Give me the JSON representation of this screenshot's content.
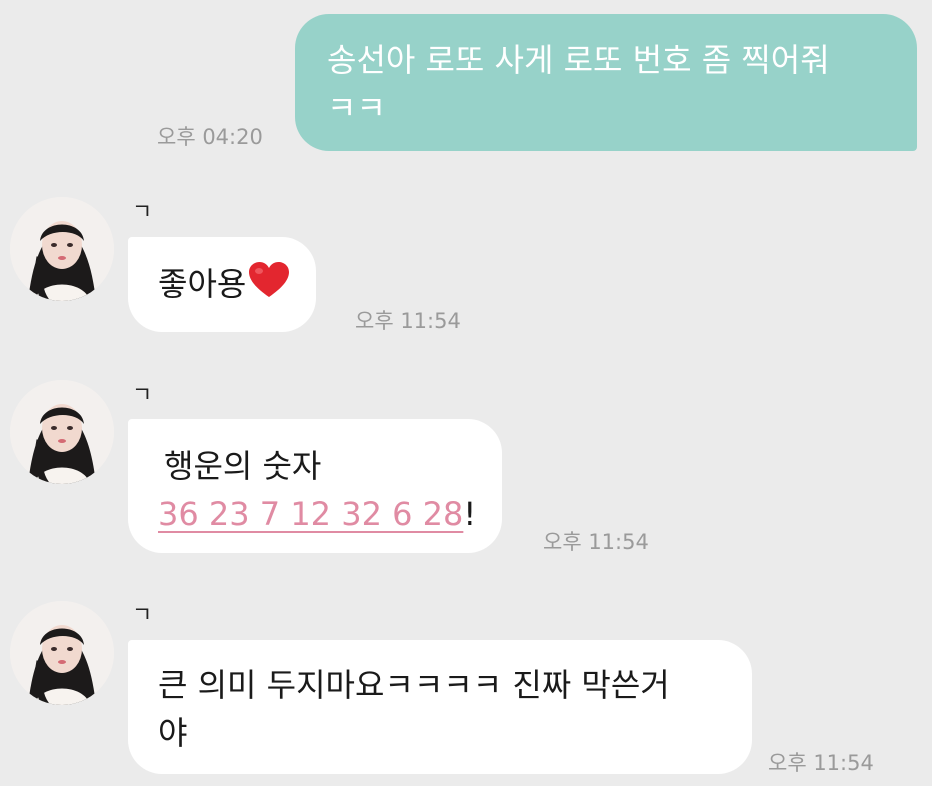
{
  "messages": [
    {
      "direction": "outgoing",
      "text_line1": "송선아 로또 사게 로또 번호 좀 찍어줘",
      "text_line2": "ㅋㅋ",
      "time": "오후 04:20"
    },
    {
      "direction": "incoming",
      "sender": "ㄱ",
      "text": "좋아용",
      "emoji": "heart-icon",
      "time": "오후 11:54"
    },
    {
      "direction": "incoming",
      "sender": "ㄱ",
      "text_line1": "행운의 숫자",
      "numbers": "36 23 7 12 32 6 28",
      "suffix": "!",
      "time": "오후 11:54"
    },
    {
      "direction": "incoming",
      "sender": "ㄱ",
      "text_line1": "큰 의미 두지마요ㅋㅋㅋㅋ 진짜 막쓴거",
      "text_line2": "야",
      "time": "오후 11:54"
    }
  ],
  "colors": {
    "background": "#ebebeb",
    "outgoing_bubble": "#97d2c9",
    "incoming_bubble": "#ffffff",
    "lotto_numbers": "#e08ba3",
    "heart": "#e3262f"
  }
}
